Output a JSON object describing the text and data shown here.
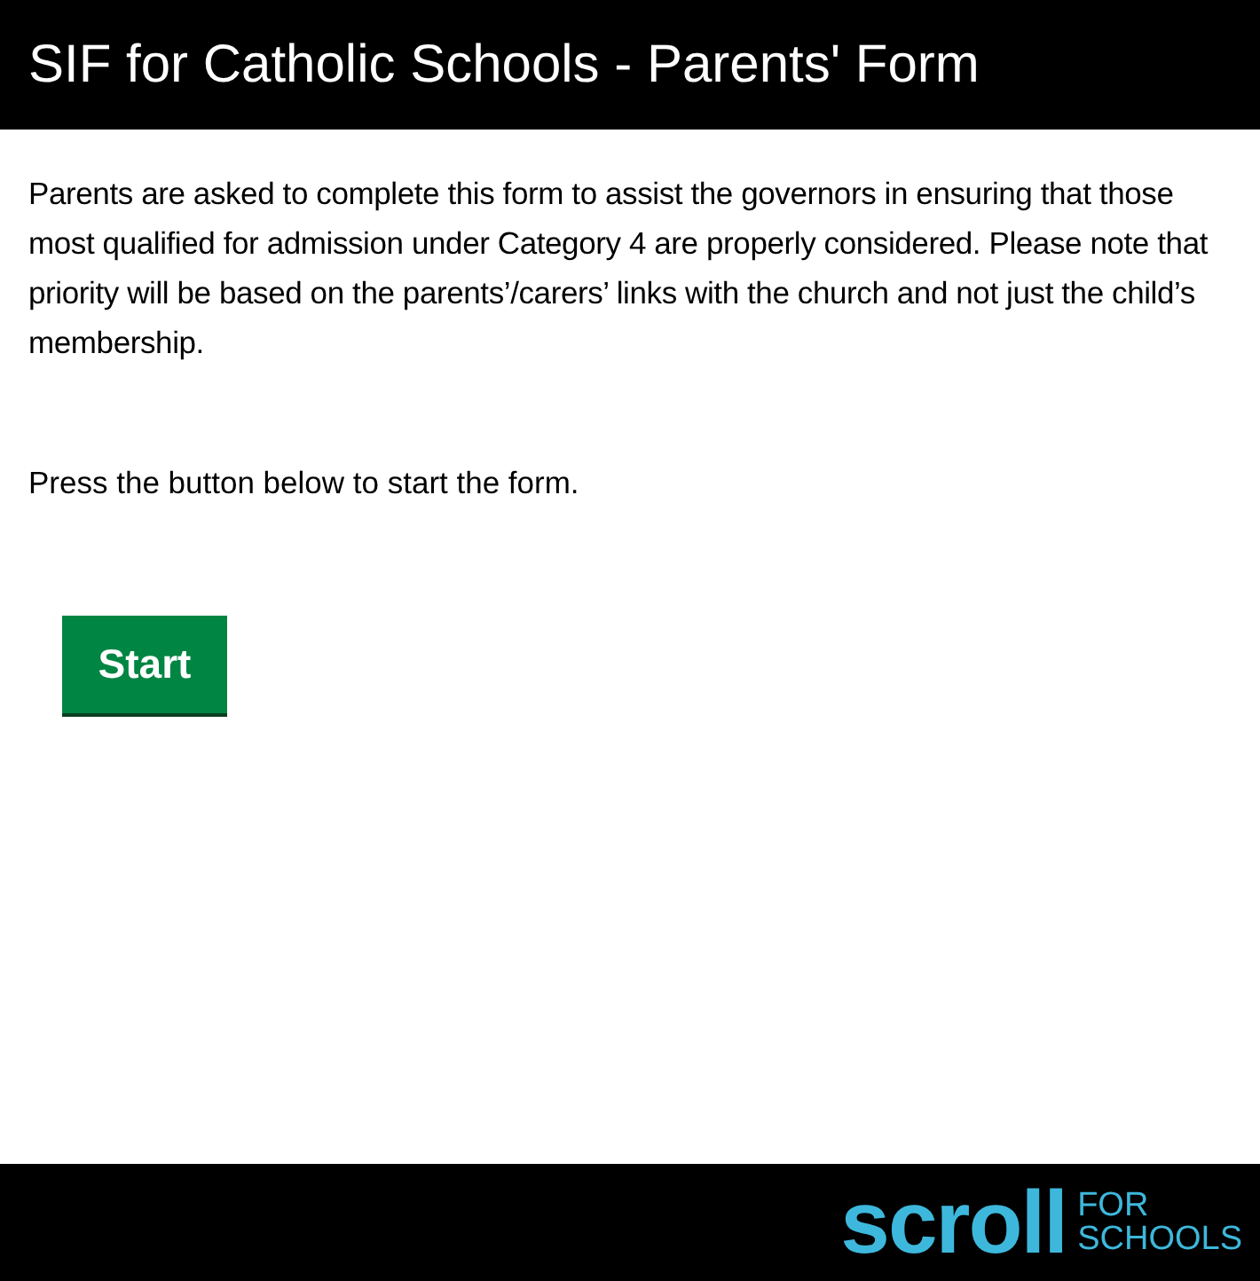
{
  "header": {
    "title": "SIF for Catholic Schools - Parents' Form"
  },
  "intro": "Parents are asked to complete this form to assist the governors in ensuring that those most qualified for admission under Category 4 are properly considered. Please note that priority will be based on the parents’/carers’ links with the church and not just the child’s membership.",
  "instruction": "Press the button below to start the form.",
  "start_button": "Start",
  "footer": {
    "logo_word": "scroll",
    "logo_tagline": [
      "FOR",
      "SCHOOLS"
    ]
  }
}
